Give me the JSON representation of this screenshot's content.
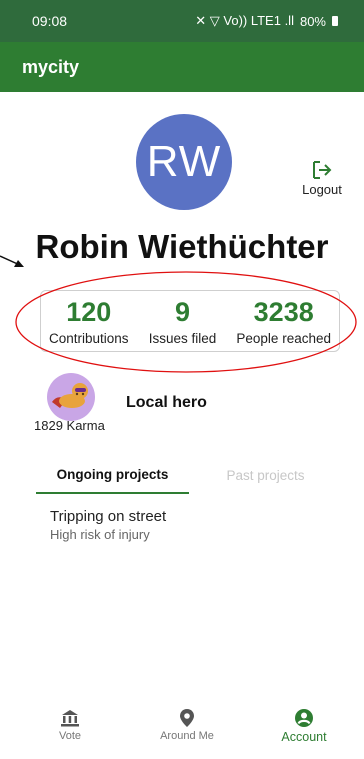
{
  "status_bar": {
    "time": "09:08",
    "indicators": "✕ ▽ Vo)) LTE1 .ll",
    "battery": "80%"
  },
  "app": {
    "title": "mycity"
  },
  "profile": {
    "initials": "RW",
    "name": "Robin Wiethüchter",
    "logout_label": "Logout"
  },
  "stats": [
    {
      "value": "120",
      "label": "Contributions"
    },
    {
      "value": "9",
      "label": "Issues filed"
    },
    {
      "value": "3238",
      "label": "People reached"
    }
  ],
  "badge": {
    "title": "Local hero",
    "karma": "1829 Karma"
  },
  "tabs": [
    {
      "label": "Ongoing projects",
      "active": true
    },
    {
      "label": "Past projects",
      "active": false
    }
  ],
  "projects": [
    {
      "title": "Tripping on street",
      "subtitle": "High risk of injury"
    }
  ],
  "bottom_nav": [
    {
      "label": "Vote",
      "icon": "bank-icon",
      "active": false
    },
    {
      "label": "Around Me",
      "icon": "map-pin-icon",
      "active": false
    },
    {
      "label": "Account",
      "icon": "account-icon",
      "active": true
    }
  ],
  "colors": {
    "primary": "#2e7d32",
    "status_bar": "#2f6b3c",
    "avatar": "#5a72c4",
    "highlight": "#e01010"
  }
}
